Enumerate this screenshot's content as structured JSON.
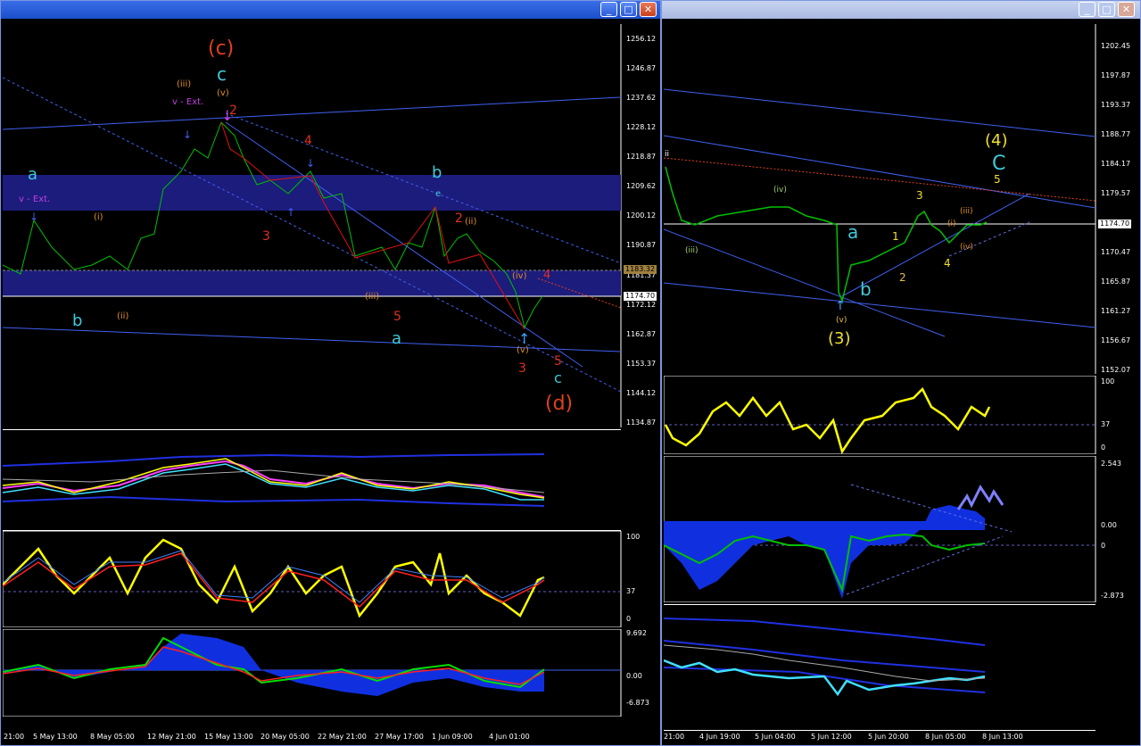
{
  "left_window": {
    "controls": {
      "minimize": "_",
      "maximize": "□",
      "close": "✕"
    },
    "price_axis": [
      "1256.12",
      "1246.87",
      "1237.62",
      "1228.12",
      "1218.87",
      "1209.62",
      "1200.12",
      "1190.87",
      "1181.37",
      "1172.12",
      "1162.87",
      "1153.37",
      "1144.12",
      "1134.87"
    ],
    "price_markers": {
      "upper": "1183.32",
      "current": "1174.70"
    },
    "rsi_axis": [
      "100",
      "37",
      "0"
    ],
    "macd_axis": [
      "9.692",
      "0.00",
      "-6.873"
    ],
    "time_axis": [
      "21:00",
      "5 May 13:00",
      "8 May 05:00",
      "12 May 21:00",
      "15 May 13:00",
      "20 May 05:00",
      "22 May 21:00",
      "27 May 17:00",
      "1 Jun 09:00",
      "4 Jun 01:00"
    ],
    "wave_labels": {
      "c_major": "(c)",
      "c_cyan": "c",
      "v_top": "(v)",
      "two_top": "2",
      "iii_top": "(iii)",
      "v_ext_1": "v - Ext.",
      "v_ext_2": "v - Ext.",
      "a_left": "a",
      "b_left": "b",
      "four_red": "4",
      "b_cyan": "b",
      "e_cyan": "e",
      "two_red": "2",
      "three_red": "3",
      "five_red": "5",
      "a_cyan": "a",
      "three_red_low": "3",
      "five_red_low": "5",
      "c_cyan_low": "c",
      "d_major": "(d)",
      "ii_orange": "(ii)",
      "iii_orange": "(iii)",
      "v_orange": "(v)",
      "iv_orange": "(iv)",
      "four_red_right": "4",
      "iv_ii": "(ii)",
      "i_orange": "(i)"
    }
  },
  "right_window": {
    "controls": {
      "minimize": "_",
      "maximize": "□",
      "close": "✕"
    },
    "price_axis": [
      "1202.45",
      "1197.87",
      "1193.37",
      "1188.77",
      "1184.17",
      "1179.57",
      "1174.70",
      "1170.47",
      "1165.87",
      "1161.27",
      "1156.67",
      "1152.07"
    ],
    "price_marker": "1174.70",
    "rsi_axis": [
      "100",
      "37",
      "0"
    ],
    "macd_axis": [
      "2.543",
      "0.00",
      "0",
      "-2.873"
    ],
    "time_axis": [
      "21:00",
      "4 Jun 19:00",
      "5 Jun 04:00",
      "5 Jun 12:00",
      "5 Jun 20:00",
      "8 Jun 05:00",
      "8 Jun 13:00"
    ],
    "wave_labels": {
      "four_major": "(4)",
      "c_cyan": "C",
      "five_y": "5",
      "three_y": "3",
      "one_y": "1",
      "two_y": "2",
      "four_y": "4",
      "a_cyan": "a",
      "b_cyan": "b",
      "three_major": "(3)",
      "v_label": "(v)",
      "iv_label": "(iv)",
      "iii_label": "(iii)",
      "ii_label": "ii",
      "i_label": "(i)",
      "iii_small": "(iii)",
      "iv_small": "(iv)"
    }
  },
  "colors": {
    "bull": "#00c000",
    "bear": "#e01010",
    "zone": "#1a1a7a",
    "rsi": "#ffff00",
    "macd_fill": "#1030e0",
    "wave_cyan": "#40c8d8",
    "wave_red": "#e03020",
    "wave_orange": "#e09020",
    "wave_yellow": "#f0e030"
  }
}
